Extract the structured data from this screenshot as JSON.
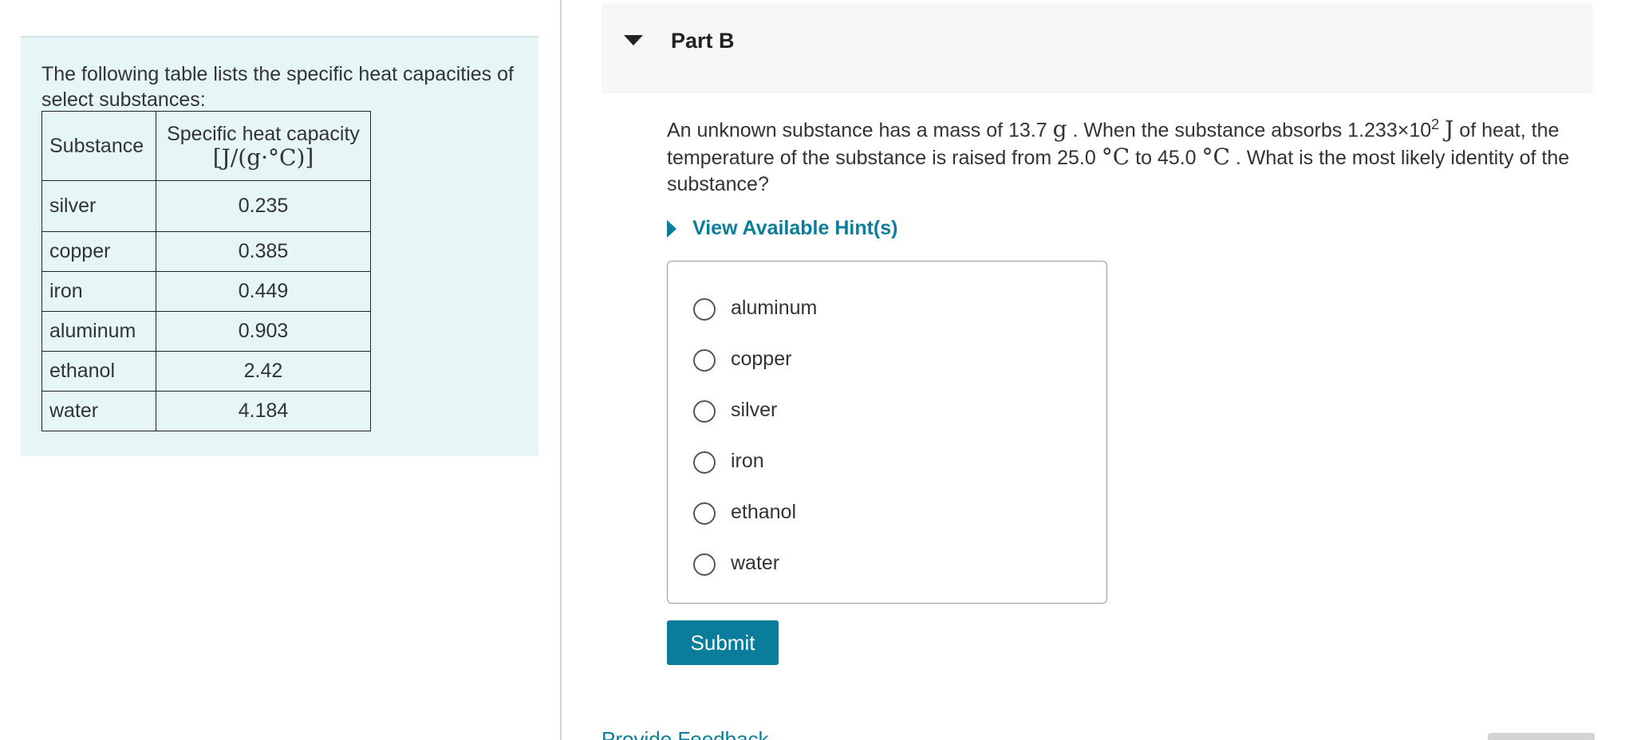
{
  "left": {
    "intro": "The following table lists the specific heat capacities of select substances:",
    "table": {
      "headers": [
        "Substance",
        "Specific heat capacity",
        "[J/(g·°C)]"
      ],
      "rows": [
        [
          "silver",
          "0.235"
        ],
        [
          "copper",
          "0.385"
        ],
        [
          "iron",
          "0.449"
        ],
        [
          "aluminum",
          "0.903"
        ],
        [
          "ethanol",
          "2.42"
        ],
        [
          "water",
          "4.184"
        ]
      ]
    }
  },
  "part": {
    "title": "Part B",
    "question": {
      "t1": "An unknown substance has a mass of 13.7 ",
      "g": "g",
      "t2": " . When the substance absorbs 1.233×10",
      "exp": "2",
      "J": "J",
      "t3": " of heat, the temperature of the substance is raised from 25.0 ",
      "deg1": "°C",
      "t4": " to 45.0 ",
      "deg2": "°C",
      "t5": " . What is the most likely identity of the substance?"
    },
    "hint": "View Available Hint(s)",
    "choices": [
      "aluminum",
      "copper",
      "silver",
      "iron",
      "ethanol",
      "water"
    ],
    "submit": "Submit",
    "feedback": "Provide Feedback"
  }
}
